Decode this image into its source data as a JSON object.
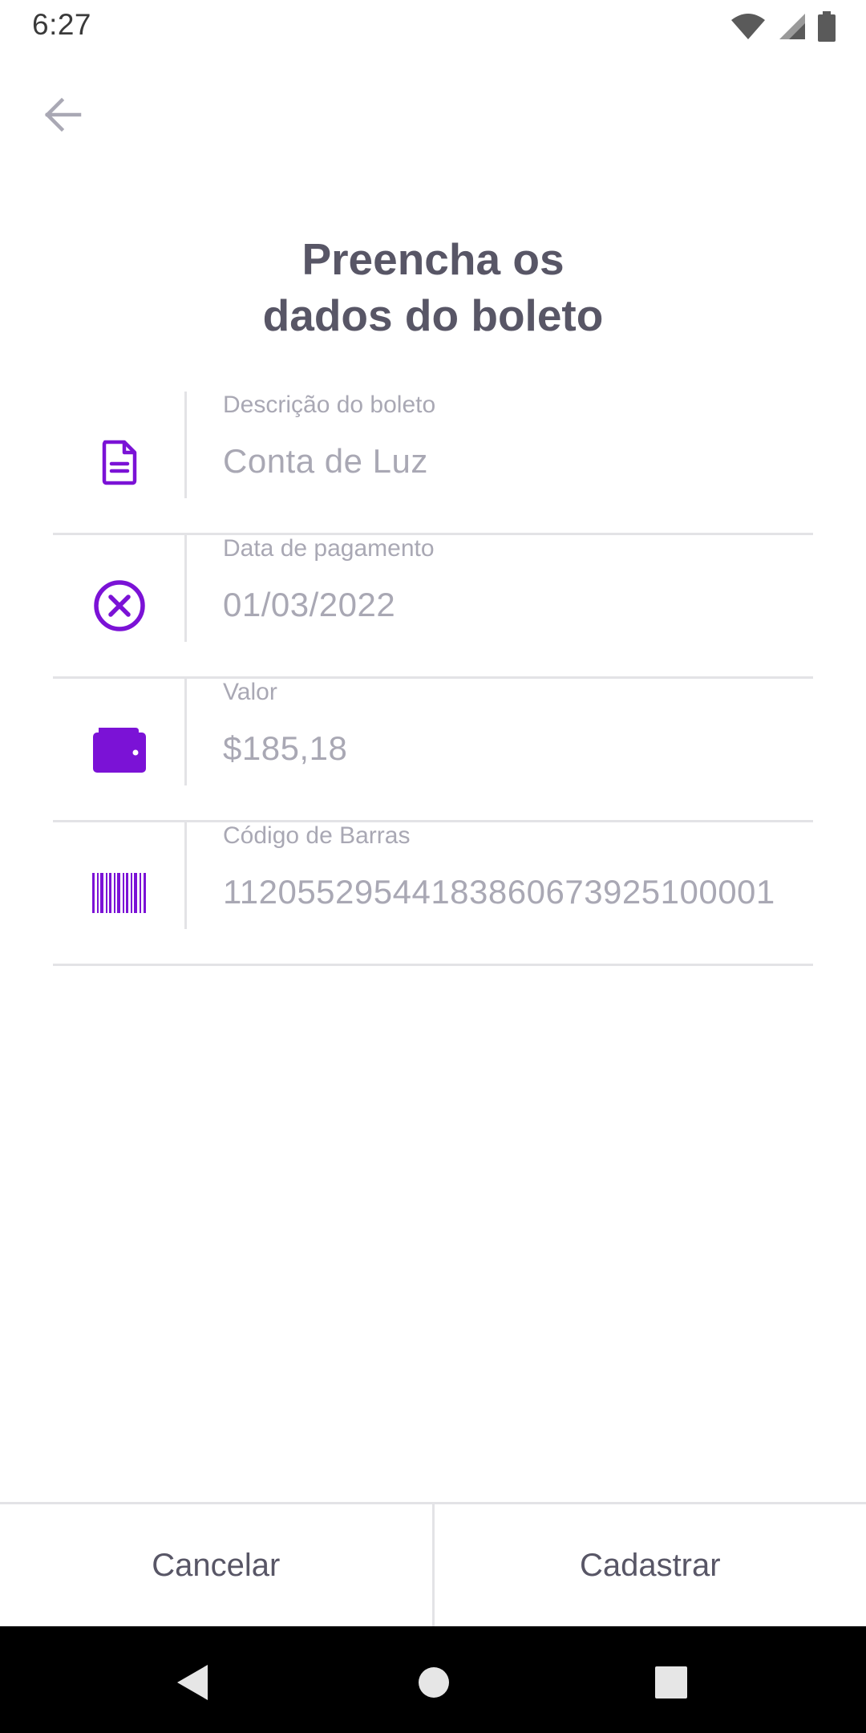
{
  "status_bar": {
    "time": "6:27",
    "icons": [
      "wifi-icon",
      "cell-signal-icon",
      "battery-icon"
    ]
  },
  "header": {
    "back_icon": "arrow-left-icon",
    "title_line1": "Preencha os",
    "title_line2": "dados do boleto"
  },
  "form": {
    "fields": [
      {
        "icon": "document-icon",
        "label": "Descrição do boleto",
        "value": "Conta de Luz"
      },
      {
        "icon": "x-circle-icon",
        "label": "Data de pagamento",
        "value": "01/03/2022"
      },
      {
        "icon": "wallet-icon",
        "label": "Valor",
        "value": "$185,18"
      },
      {
        "icon": "barcode-icon",
        "label": "Código de Barras",
        "value": "11205529544183860673925100001"
      }
    ]
  },
  "actions": {
    "cancel_label": "Cancelar",
    "submit_label": "Cadastrar"
  },
  "nav_bar": {
    "icons": [
      "nav-back-icon",
      "nav-home-icon",
      "nav-recents-icon"
    ]
  },
  "colors": {
    "accent": "#7b12d6",
    "heading": "#585666",
    "muted_text": "#a9a8b4",
    "divider": "#e3e3e6"
  }
}
